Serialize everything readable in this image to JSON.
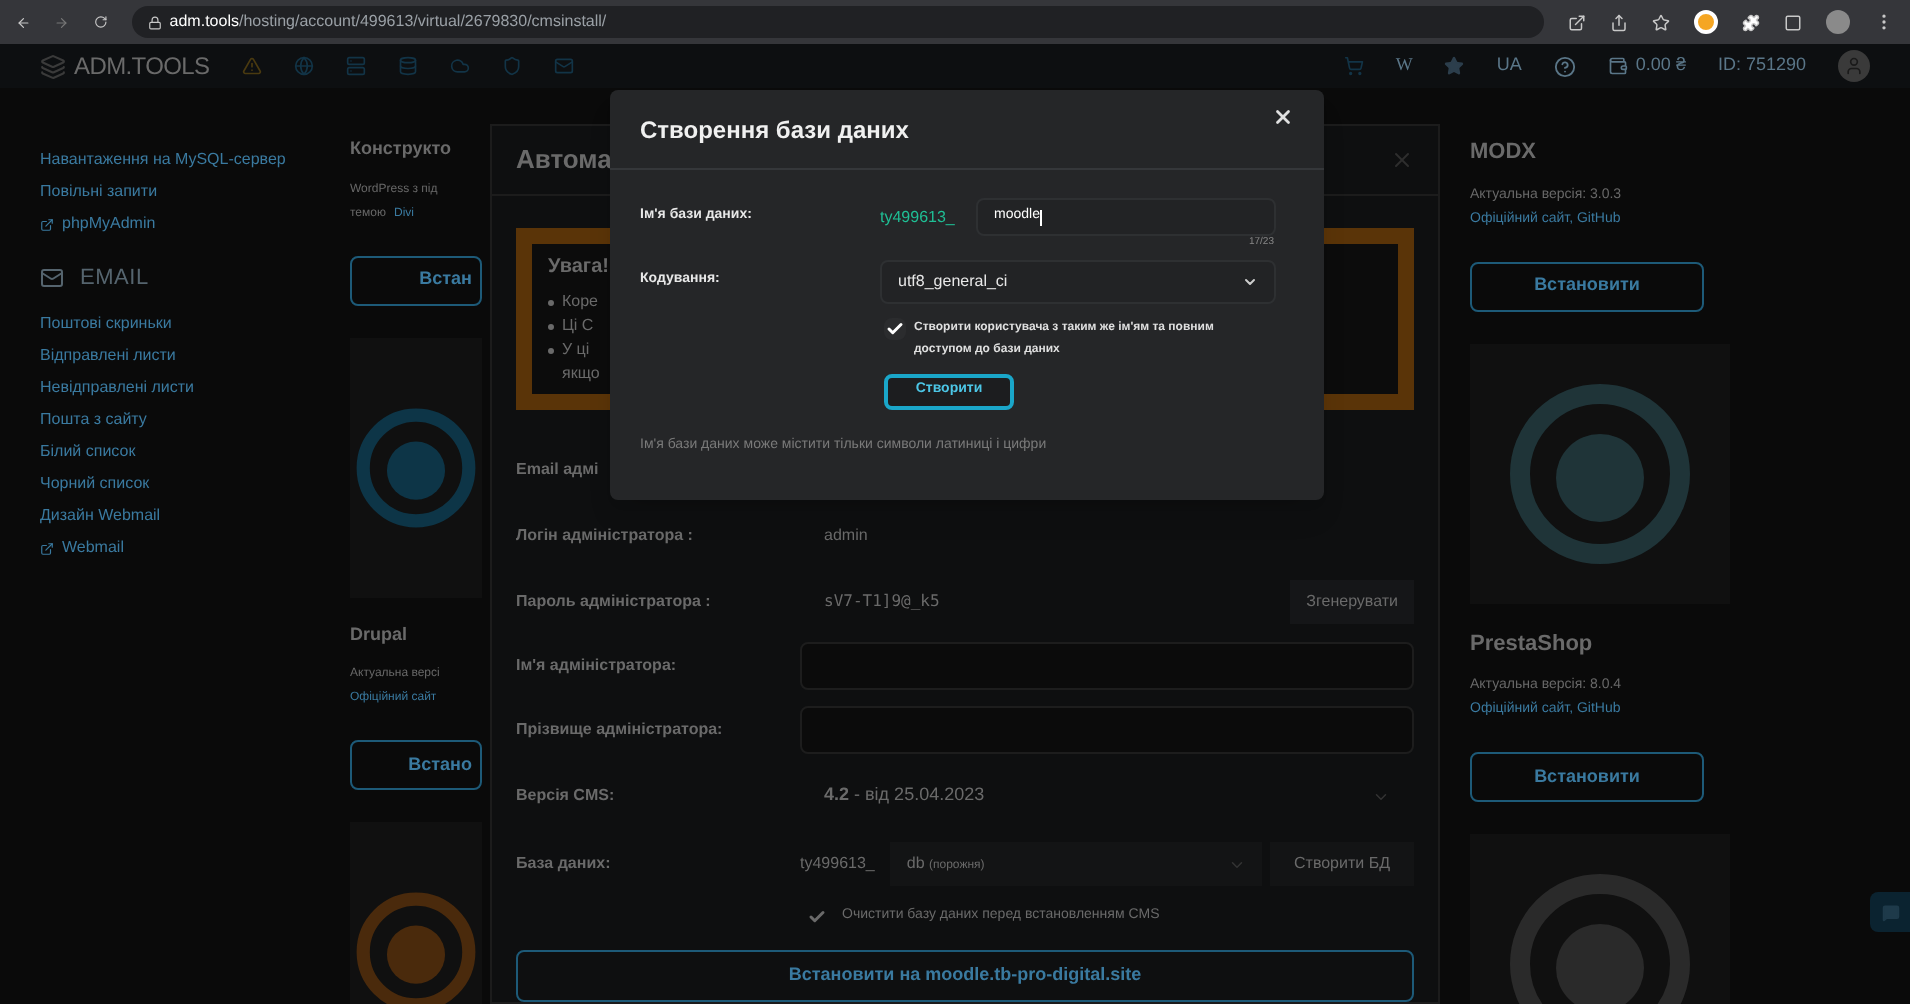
{
  "browser": {
    "url_host": "adm.tools",
    "url_path": "/hosting/account/499613/virtual/2679830/cmsinstall/"
  },
  "header": {
    "logo": "ADM.TOOLS",
    "toolbar_glyph": "W",
    "language": "UA",
    "balance": "0.00 ₴",
    "account_id": "ID: 751290"
  },
  "sidebar": [
    {
      "kind": "item",
      "label": "Навантаження на MySQL-сервер"
    },
    {
      "kind": "item",
      "label": "Повільні запити"
    },
    {
      "kind": "external",
      "label": "phpMyAdmin"
    },
    {
      "kind": "section",
      "label": "EMAIL"
    },
    {
      "kind": "item",
      "label": "Поштові скриньки"
    },
    {
      "kind": "item",
      "label": "Відправлені листи"
    },
    {
      "kind": "item",
      "label": "Невідправлені листи"
    },
    {
      "kind": "item",
      "label": "Пошта з сайту"
    },
    {
      "kind": "item",
      "label": "Білий список"
    },
    {
      "kind": "item",
      "label": "Чорний список"
    },
    {
      "kind": "item",
      "label": "Дизайн Webmail"
    },
    {
      "kind": "external",
      "label": "Webmail"
    }
  ],
  "left_column": [
    {
      "kind": "card",
      "title": "Конструкто",
      "lines": [
        {
          "text": "WordPress з під"
        },
        {
          "text": "темою",
          "link": "Divi"
        }
      ],
      "button": "Встан"
    },
    {
      "kind": "image"
    },
    {
      "kind": "card",
      "title": "Drupal",
      "lines": [
        {
          "text": "Актуальна версі"
        },
        {
          "link": "Офіційний сайт"
        }
      ],
      "button": "Встано"
    },
    {
      "kind": "image"
    }
  ],
  "right_column": [
    {
      "kind": "card",
      "title": "MODX",
      "lines": [
        {
          "text": "Актуальна версія: 3.0.3"
        },
        {
          "link": "Офіційний сайт, GitHub"
        }
      ],
      "button": "Встановити"
    },
    {
      "kind": "image"
    },
    {
      "kind": "card",
      "title": "PrestaShop",
      "lines": [
        {
          "text": "Актуальна версія: 8.0.4"
        },
        {
          "link": "Офіційний сайт, GitHub"
        }
      ],
      "button": "Встановити"
    },
    {
      "kind": "image"
    }
  ],
  "install_dialog": {
    "title": "Автома",
    "warning": {
      "title": "Увага!",
      "bullets": [
        {
          "lines": [
            "Коре"
          ]
        },
        {
          "lines": [
            "Ці С"
          ]
        },
        {
          "lines": [
            "У ці",
            "якщо"
          ]
        }
      ]
    },
    "rows": [
      {
        "kind": "label",
        "label": "Email адмі"
      },
      {
        "kind": "value",
        "label": "Логін адміністратора :",
        "value": "admin"
      },
      {
        "kind": "password",
        "label": "Пароль адміністратора :",
        "value": "sV7-T1]9@_k5",
        "button": "Згенерувати"
      },
      {
        "kind": "input",
        "label": "Ім'я адміністратора:"
      },
      {
        "kind": "input",
        "label": "Прізвище адміністратора:"
      },
      {
        "kind": "select",
        "label": "Версія CMS:",
        "value": "4.2",
        "note": "- від 25.04.2023"
      },
      {
        "kind": "database",
        "label": "База даних:",
        "prefix": "ty499613_",
        "value": "db",
        "note": "(порожня)",
        "button": "Створити БД"
      }
    ],
    "checkbox": {
      "label": "Очистити базу даних перед встановленням CMS",
      "checked": true
    },
    "install_button": "Встановити на moodle.tb-pro-digital.site"
  },
  "db_dialog": {
    "title": "Створення бази даних",
    "name": {
      "label": "Ім'я бази даних:",
      "prefix": "ty499613_",
      "value": "moodle",
      "counter": "17/23"
    },
    "encoding": {
      "label": "Кодування:",
      "value": "utf8_general_ci"
    },
    "checkbox": {
      "label": "Створити користувача з таким же ім'ям та повним доступом до бази даних",
      "checked": true
    },
    "button": "Створити",
    "hint": "Ім'я бази даних може містити тільки символи латиниці і цифри"
  }
}
